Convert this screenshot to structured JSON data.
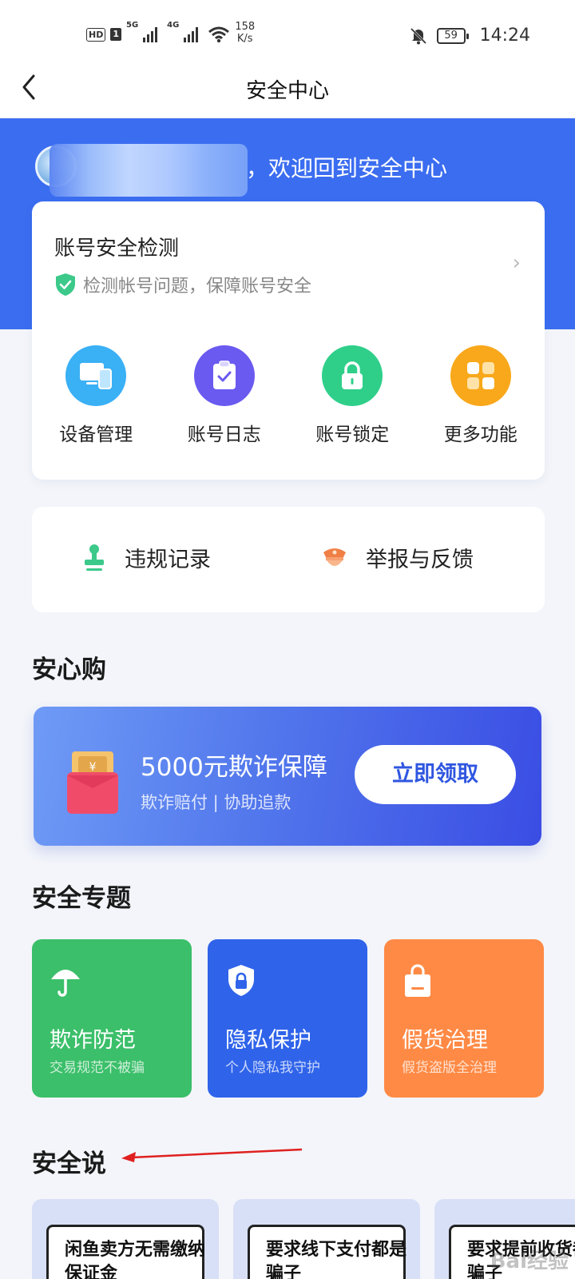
{
  "status_bar": {
    "hd_badge": "HD",
    "sim": "1",
    "network_1": "5G",
    "network_2": "4G",
    "speed_value": "158",
    "speed_unit": "K/s",
    "battery": "59",
    "time": "14:24",
    "icons": [
      "signal-icon",
      "wifi-icon",
      "mute-bell-icon",
      "battery-icon"
    ]
  },
  "nav": {
    "back_icon": "chevron-left-icon",
    "title": "安全中心"
  },
  "hero": {
    "welcome": "，欢迎回到安全中心",
    "background_color": "#3b6df0"
  },
  "account_check": {
    "title": "账号安全检测",
    "subtitle": "检测帐号问题，保障账号安全",
    "icon": "shield-check-icon",
    "chevron": "›"
  },
  "quick_actions": [
    {
      "label": "设备管理",
      "icon": "devices-icon",
      "color": "#3ab0f5"
    },
    {
      "label": "账号日志",
      "icon": "clipboard-check-icon",
      "color": "#6a5af0"
    },
    {
      "label": "账号锁定",
      "icon": "lock-icon",
      "color": "#2fcf8a"
    },
    {
      "label": "更多功能",
      "icon": "grid-icon",
      "color": "#f8a81a"
    }
  ],
  "report": {
    "violation": {
      "label": "违规记录",
      "icon": "stamp-icon"
    },
    "feedback": {
      "label": "举报与反馈",
      "icon": "police-cap-icon"
    }
  },
  "sections": {
    "safe_buy": "安心购",
    "topics": "安全专题",
    "talk": "安全说"
  },
  "promo": {
    "title": "5000元欺诈保障",
    "subtitle": "欺诈赔付 | 协助追款",
    "button": "立即领取",
    "icon": "red-envelope-icon"
  },
  "topics": [
    {
      "title": "欺诈防范",
      "subtitle": "交易规范不被骗",
      "icon": "umbrella-icon",
      "color": "#3bbf6a"
    },
    {
      "title": "隐私保护",
      "subtitle": "个人隐私我守护",
      "icon": "shield-lock-icon",
      "color": "#2f63ea"
    },
    {
      "title": "假货治理",
      "subtitle": "假货盗版全治理",
      "icon": "shopping-bag-icon",
      "color": "#ff8a45"
    }
  ],
  "talk_cards": [
    {
      "text": "闲鱼卖方无需缴纳保证金"
    },
    {
      "text": "要求线下支付都是骗子"
    },
    {
      "text": "要求提前收货都是骗子"
    }
  ],
  "watermark": "Bai经验"
}
